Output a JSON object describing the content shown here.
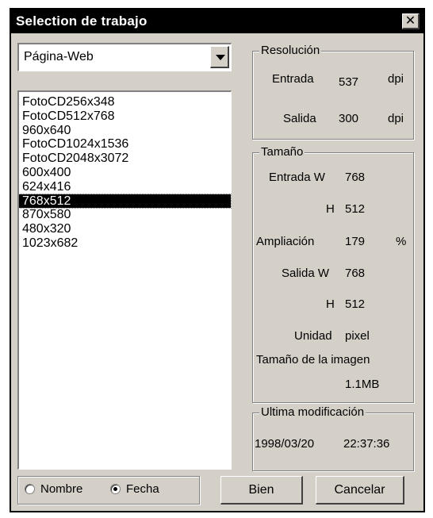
{
  "window": {
    "title": "Selection de trabajo",
    "close_glyph": "✕"
  },
  "preset_select": {
    "value": "Página-Web"
  },
  "job_list": {
    "items": [
      "FotoCD256x348",
      "FotoCD512x768",
      "960x640",
      "FotoCD1024x1536",
      "FotoCD2048x3072",
      "600x400",
      "624x416",
      "768x512",
      "870x580",
      "480x320",
      "1023x682"
    ],
    "selected_index": 7
  },
  "resolution": {
    "title": "Resolución",
    "input_label": "Entrada",
    "input_value": "537",
    "input_unit": "dpi",
    "output_label": "Salida",
    "output_value": "300",
    "output_unit": "dpi"
  },
  "size": {
    "title": "Tamaño",
    "input_w_label": "Entrada W",
    "input_w_value": "768",
    "input_h_label": "H",
    "input_h_value": "512",
    "zoom_label": "Ampliación",
    "zoom_value": "179",
    "zoom_unit": "%",
    "output_w_label": "Salida W",
    "output_w_value": "768",
    "output_h_label": "H",
    "output_h_value": "512",
    "unit_label": "Unidad",
    "unit_value": "pixel",
    "image_size_label": "Tamaño de la imagen",
    "image_size_value": "1.1MB"
  },
  "last_modified": {
    "title": "Ultima modificación",
    "date": "1998/03/20",
    "time": "22:37:36"
  },
  "sort": {
    "name_label": "Nombre",
    "date_label": "Fecha",
    "selected": "date"
  },
  "buttons": {
    "ok": "Bien",
    "cancel": "Cancelar"
  },
  "colors": {
    "face": "#d4d0c8",
    "titlebar": "#000000",
    "selection": "#000000"
  }
}
